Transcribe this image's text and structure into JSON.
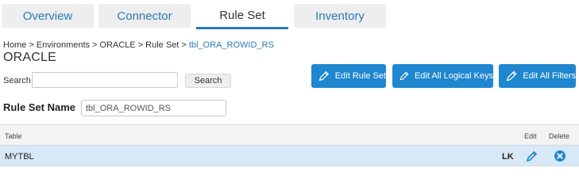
{
  "tabs": [
    {
      "label": "Overview",
      "active": false
    },
    {
      "label": "Connector",
      "active": false
    },
    {
      "label": "Rule Set",
      "active": true
    },
    {
      "label": "Inventory",
      "active": false
    }
  ],
  "breadcrumb": {
    "items": [
      "Home",
      "Environments",
      "ORACLE",
      "Rule Set",
      "tbl_ORA_ROWID_RS"
    ],
    "separator": ">"
  },
  "page_title": "ORACLE",
  "search": {
    "label": "Search",
    "value": "",
    "button_label": "Search"
  },
  "actions": {
    "edit_rule_set": "Edit Rule Set",
    "edit_all_logical_keys": "Edit All Logical Keys",
    "edit_all_filters": "Edit All Filters"
  },
  "rule_set": {
    "label": "Rule Set Name",
    "value": "tbl_ORA_ROWID_RS"
  },
  "table": {
    "headers": {
      "table": "Table",
      "edit": "Edit",
      "delete": "Delete"
    },
    "rows": [
      {
        "table": "MYTBL",
        "key_badge": "LK"
      }
    ]
  },
  "colors": {
    "accent": "#2a7ab8",
    "button_primary": "#1f87cf",
    "row_selected": "#d8e8f6"
  },
  "icons": {
    "action_button": "pencil-icon",
    "row_edit": "pencil-icon",
    "row_delete": "close-circle-icon"
  }
}
